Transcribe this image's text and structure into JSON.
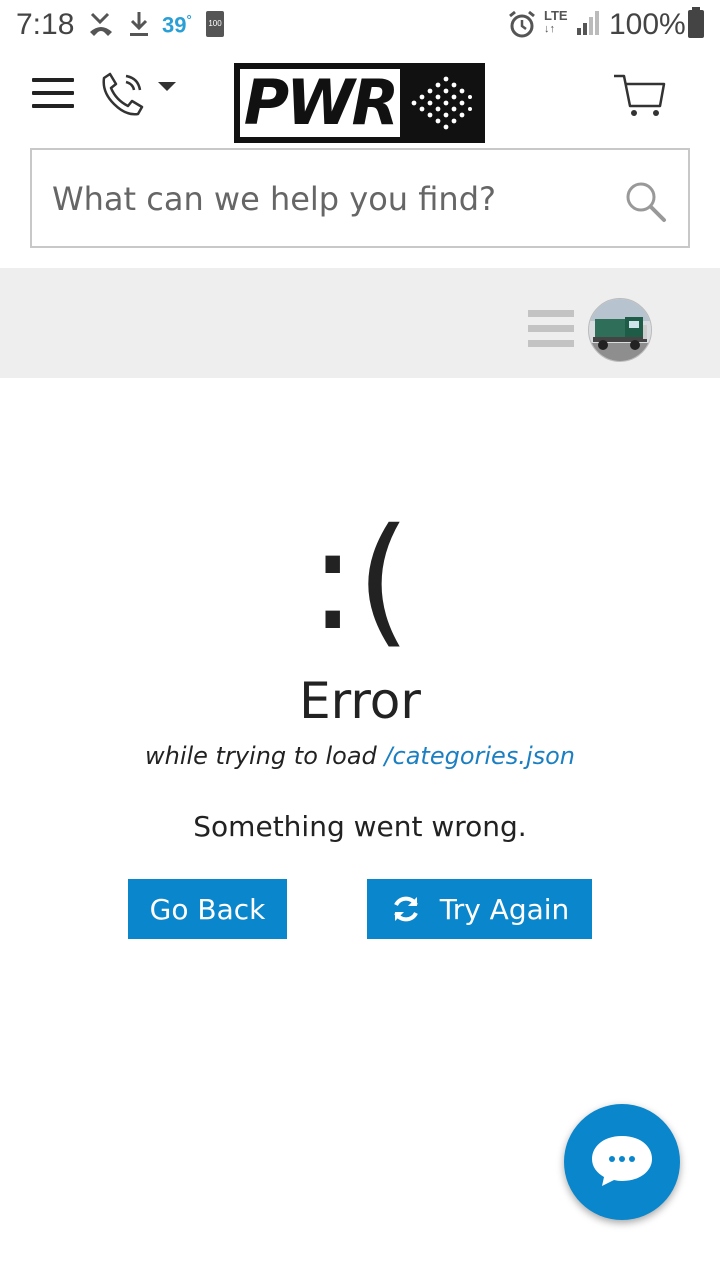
{
  "status_bar": {
    "time": "7:18",
    "temperature": "39",
    "temperature_unit": "°",
    "battery_badge": "100",
    "network": "LTE",
    "battery_percent": "100%"
  },
  "header": {
    "logo_text": "PWR",
    "search_placeholder": "What can we help you find?"
  },
  "error": {
    "face": ":(",
    "title": "Error",
    "context_prefix": "while trying to load ",
    "context_path": "/categories.json",
    "message": "Something went wrong."
  },
  "actions": {
    "go_back_label": "Go Back",
    "try_again_label": "Try Again"
  },
  "colors": {
    "accent": "#0a86cc",
    "link": "#1c7fc1",
    "sub_bar_bg": "#eeeeee"
  },
  "icons": {
    "menu": "hamburger-icon",
    "phone": "phone-icon",
    "cart": "cart-icon",
    "search": "search-icon",
    "refresh": "refresh-icon",
    "chat": "chat-icon"
  }
}
